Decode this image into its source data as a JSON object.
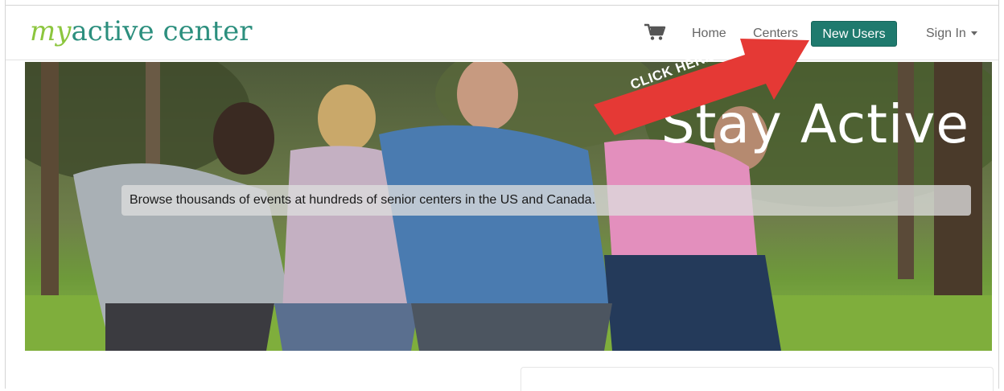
{
  "brand": {
    "prefix": "my",
    "suffix": "active center"
  },
  "nav": {
    "home": "Home",
    "centers": "Centers",
    "new_users": "New Users",
    "sign_in": "Sign In"
  },
  "hero": {
    "title": "Stay Active",
    "caption": "Browse thousands of events at hundreds of senior centers in the US and Canada."
  },
  "annotation": {
    "label": "CLICK HERE"
  },
  "colors": {
    "brand_green": "#8cc63e",
    "brand_teal": "#2c8f7e",
    "button": "#1f7a6e",
    "arrow": "#e53935"
  },
  "icons": [
    "cart-icon",
    "caret-down-icon",
    "arrow-annotation"
  ]
}
